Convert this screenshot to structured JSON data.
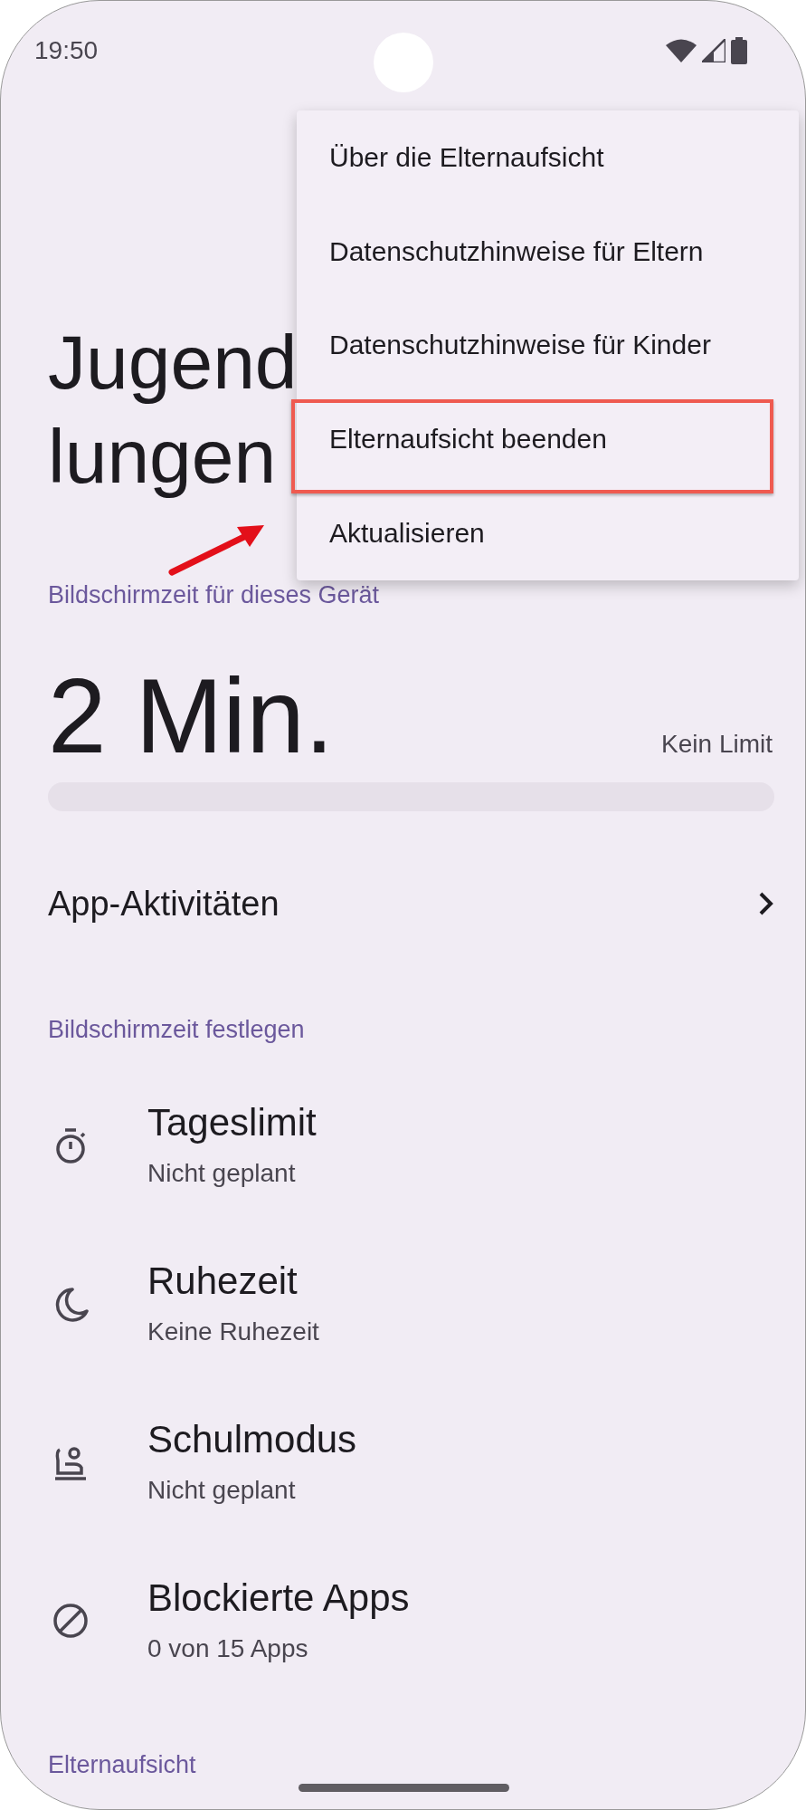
{
  "status_bar": {
    "time": "19:50"
  },
  "title_lines": [
    "Jugend",
    "lungen"
  ],
  "screen_time": {
    "label": "Bildschirmzeit für dieses Gerät",
    "value": "2 Min.",
    "limit": "Kein Limit",
    "level": 0
  },
  "app_activity": {
    "label": "App-Aktivitäten"
  },
  "sections": [
    {
      "heading": "Bildschirmzeit festlegen",
      "items": [
        {
          "kind": "timer",
          "title": "Tageslimit",
          "subtitle": "Nicht geplant"
        },
        {
          "kind": "moon",
          "title": "Ruhezeit",
          "subtitle": "Keine Ruhezeit"
        },
        {
          "kind": "school",
          "title": "Schulmodus",
          "subtitle": "Nicht geplant"
        },
        {
          "kind": "block",
          "title": "Blockierte Apps",
          "subtitle": "0 von 15 Apps"
        }
      ]
    },
    {
      "heading": "Elternaufsicht"
    }
  ],
  "menu": {
    "items": [
      {
        "label": "Über die Elternaufsicht",
        "highlighted": false
      },
      {
        "label": "Datenschutzhinweise für Eltern",
        "highlighted": false
      },
      {
        "label": "Datenschutzhinweise für Kinder",
        "highlighted": false
      },
      {
        "label": "Elternaufsicht beenden",
        "highlighted": true
      },
      {
        "label": "Aktualisieren",
        "highlighted": false
      }
    ]
  }
}
